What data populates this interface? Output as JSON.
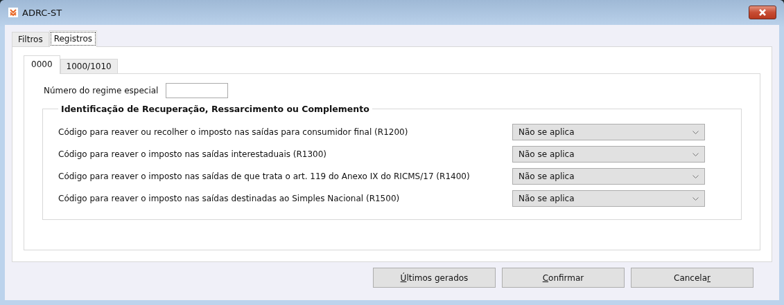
{
  "window": {
    "title": "ADRC-ST"
  },
  "tabs": [
    {
      "label": "Filtros",
      "selected": false
    },
    {
      "label": "Registros",
      "selected": true
    }
  ],
  "subtabs": [
    {
      "label": "0000",
      "selected": true
    },
    {
      "label": "1000/1010",
      "selected": false
    }
  ],
  "regime_field": {
    "label": "Número do regime especial"
  },
  "group": {
    "title": "Identificação de Recuperação, Ressarcimento ou Complemento",
    "rows": [
      {
        "label": "Código para reaver ou recolher o imposto nas saídas para consumidor final (R1200)",
        "value": "Não se aplica"
      },
      {
        "label": "Código para reaver o imposto nas saídas interestaduais (R1300)",
        "value": "Não se aplica"
      },
      {
        "label": "Código para reaver o imposto nas saídas de que trata o art. 119 do Anexo IX do RICMS/17 (R1400)",
        "value": "Não se aplica"
      },
      {
        "label": "Código para reaver o imposto nas saídas destinadas ao Simples Nacional (R1500)",
        "value": "Não se aplica"
      }
    ]
  },
  "buttons": [
    {
      "key": "Ú",
      "post": "ltimos gerados"
    },
    {
      "key": "C",
      "post": "onfirmar"
    },
    {
      "pre": "Cancela",
      "key": "r"
    }
  ]
}
